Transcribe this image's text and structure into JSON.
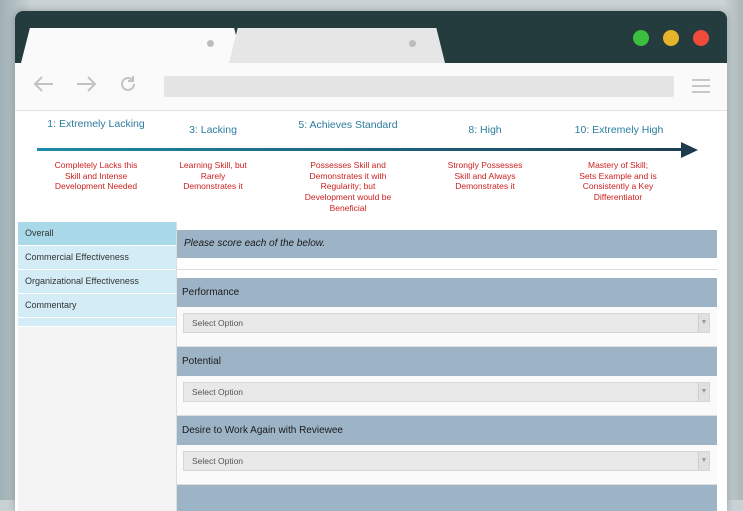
{
  "browser": {
    "icons": {
      "back": "back-arrow-icon",
      "forward": "forward-arrow-icon",
      "reload": "reload-icon",
      "menu": "hamburger-menu-icon"
    },
    "colors": {
      "titlebar": "#253c3f",
      "green": "#3bbf3e",
      "yellow": "#e6b42b",
      "red": "#f04a3a"
    }
  },
  "scale": [
    {
      "title": "1: Extremely Lacking",
      "desc": "Completely Lacks this Skill and Intense Development Needed"
    },
    {
      "title": "3: Lacking",
      "desc": "Learning Skill, but Rarely Demonstrates it"
    },
    {
      "title": "5: Achieves Standard",
      "desc": "Possesses Skill and Demonstrates it with Regularity; but Development would be Beneficial"
    },
    {
      "title": "8: High",
      "desc": "Strongly Possesses Skill and Always Demonstrates it"
    },
    {
      "title": "10: Extremely High",
      "desc": "Mastery of Skill; Sets Example and is Consistently a Key Differentiator"
    }
  ],
  "sidebar": {
    "items": [
      {
        "label": "Overall"
      },
      {
        "label": "Commercial Effectiveness"
      },
      {
        "label": "Organizational Effectiveness"
      },
      {
        "label": "Commentary"
      }
    ]
  },
  "main": {
    "intro": "Please score each of the below.",
    "questions": [
      {
        "label": "Performance",
        "select_value": "Select Option"
      },
      {
        "label": "Potential",
        "select_value": "Select Option"
      },
      {
        "label": "Desire to Work Again with Reviewee",
        "select_value": "Select Option"
      }
    ]
  }
}
